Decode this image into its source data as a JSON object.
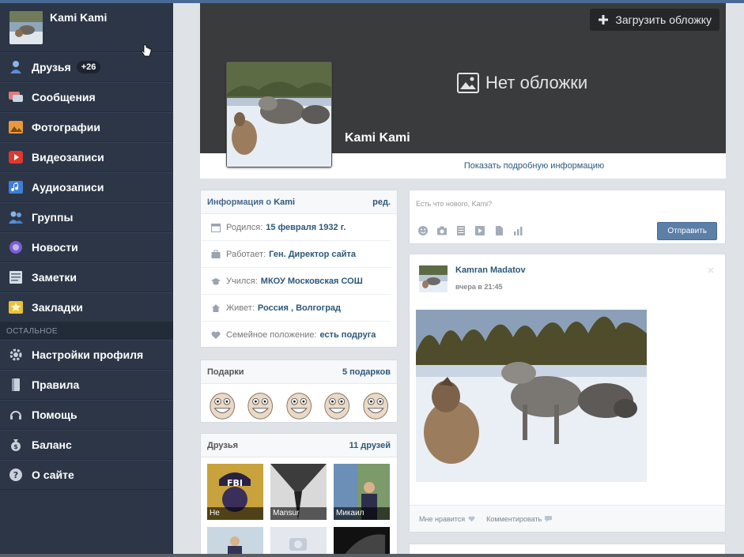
{
  "sidebar": {
    "profile_name": "Kami Kami",
    "items": [
      {
        "label": "Друзья",
        "badge": "+26",
        "icon": "friends-icon"
      },
      {
        "label": "Сообщения",
        "icon": "messages-icon"
      },
      {
        "label": "Фотографии",
        "icon": "photos-icon"
      },
      {
        "label": "Видеозаписи",
        "icon": "video-icon"
      },
      {
        "label": "Аудиозаписи",
        "icon": "audio-icon"
      },
      {
        "label": "Группы",
        "icon": "groups-icon"
      },
      {
        "label": "Новости",
        "icon": "news-icon"
      },
      {
        "label": "Заметки",
        "icon": "notes-icon"
      },
      {
        "label": "Закладки",
        "icon": "bookmarks-icon"
      }
    ],
    "section_label": "ОСТАЛЬНОЕ",
    "other": [
      {
        "label": "Настройки профиля",
        "icon": "gear-icon"
      },
      {
        "label": "Правила",
        "icon": "rules-icon"
      },
      {
        "label": "Помощь",
        "icon": "help-headset-icon"
      },
      {
        "label": "Баланс",
        "icon": "money-bag-icon"
      },
      {
        "label": "О сайте",
        "icon": "question-icon"
      }
    ]
  },
  "cover": {
    "upload_label": "Загрузить обложку",
    "no_cover_label": "Нет обложки",
    "name": "Kami Kami",
    "show_info": "Показать подробную информацию"
  },
  "info": {
    "title_prefix": "Информация о",
    "title_name": "Kami",
    "edit": "ред.",
    "rows": [
      {
        "label": "Родился:",
        "value": "15 февраля 1932 г.",
        "icon": "calendar-icon"
      },
      {
        "label": "Работает:",
        "value": "Ген. Директор сайта",
        "icon": "briefcase-icon"
      },
      {
        "label": "Учился:",
        "value": "МКОУ Московская СОШ",
        "icon": "graduation-icon"
      },
      {
        "label": "Живет:",
        "value": "Россия , Волгоград",
        "icon": "home-icon"
      },
      {
        "label": "Семейное положение:",
        "value": "есть подруга",
        "icon": "heart-icon"
      }
    ]
  },
  "gifts": {
    "title": "Подарки",
    "count": "5 подарков"
  },
  "friends": {
    "title": "Друзья",
    "count": "11 друзей",
    "items": [
      {
        "name": "Не"
      },
      {
        "name": "Mansur"
      },
      {
        "name": "Микаил"
      }
    ]
  },
  "composer": {
    "placeholder": "Есть что нового, Kami?",
    "send": "Отправить"
  },
  "post": {
    "author": "Kamran Madatov",
    "time": "вчера в 21:45",
    "like": "Мне нравится",
    "comment": "Комментировать"
  },
  "colors": {
    "sidebar_bg": "#2c3647",
    "link": "#2b587a",
    "cover_bg": "#3a3b3d"
  }
}
